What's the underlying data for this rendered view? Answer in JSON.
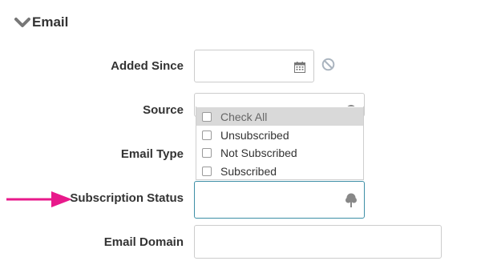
{
  "section": {
    "title": "Email",
    "chevron_icon": "chevron-down-icon"
  },
  "fields": {
    "added_since": {
      "label": "Added Since",
      "value": "",
      "icon": "calendar-icon",
      "clear_icon": "cancel-icon"
    },
    "source": {
      "label": "Source",
      "value": ""
    },
    "email_type": {
      "label": "Email Type"
    },
    "subscription_status": {
      "label": "Subscription Status",
      "value": "",
      "icon": "tree-icon"
    },
    "email_domain": {
      "label": "Email Domain",
      "value": ""
    }
  },
  "dropdown": {
    "options": [
      {
        "label": "Check All",
        "checked": false,
        "highlighted": true
      },
      {
        "label": "Unsubscribed",
        "checked": false,
        "highlighted": false
      },
      {
        "label": "Not Subscribed",
        "checked": false,
        "highlighted": false
      },
      {
        "label": "Subscribed",
        "checked": false,
        "highlighted": false
      }
    ]
  },
  "annotation": {
    "arrow_color": "#e8198b"
  },
  "colors": {
    "focus_border": "#3d8fa6",
    "text": "#333333",
    "field_border": "#cccccc"
  }
}
